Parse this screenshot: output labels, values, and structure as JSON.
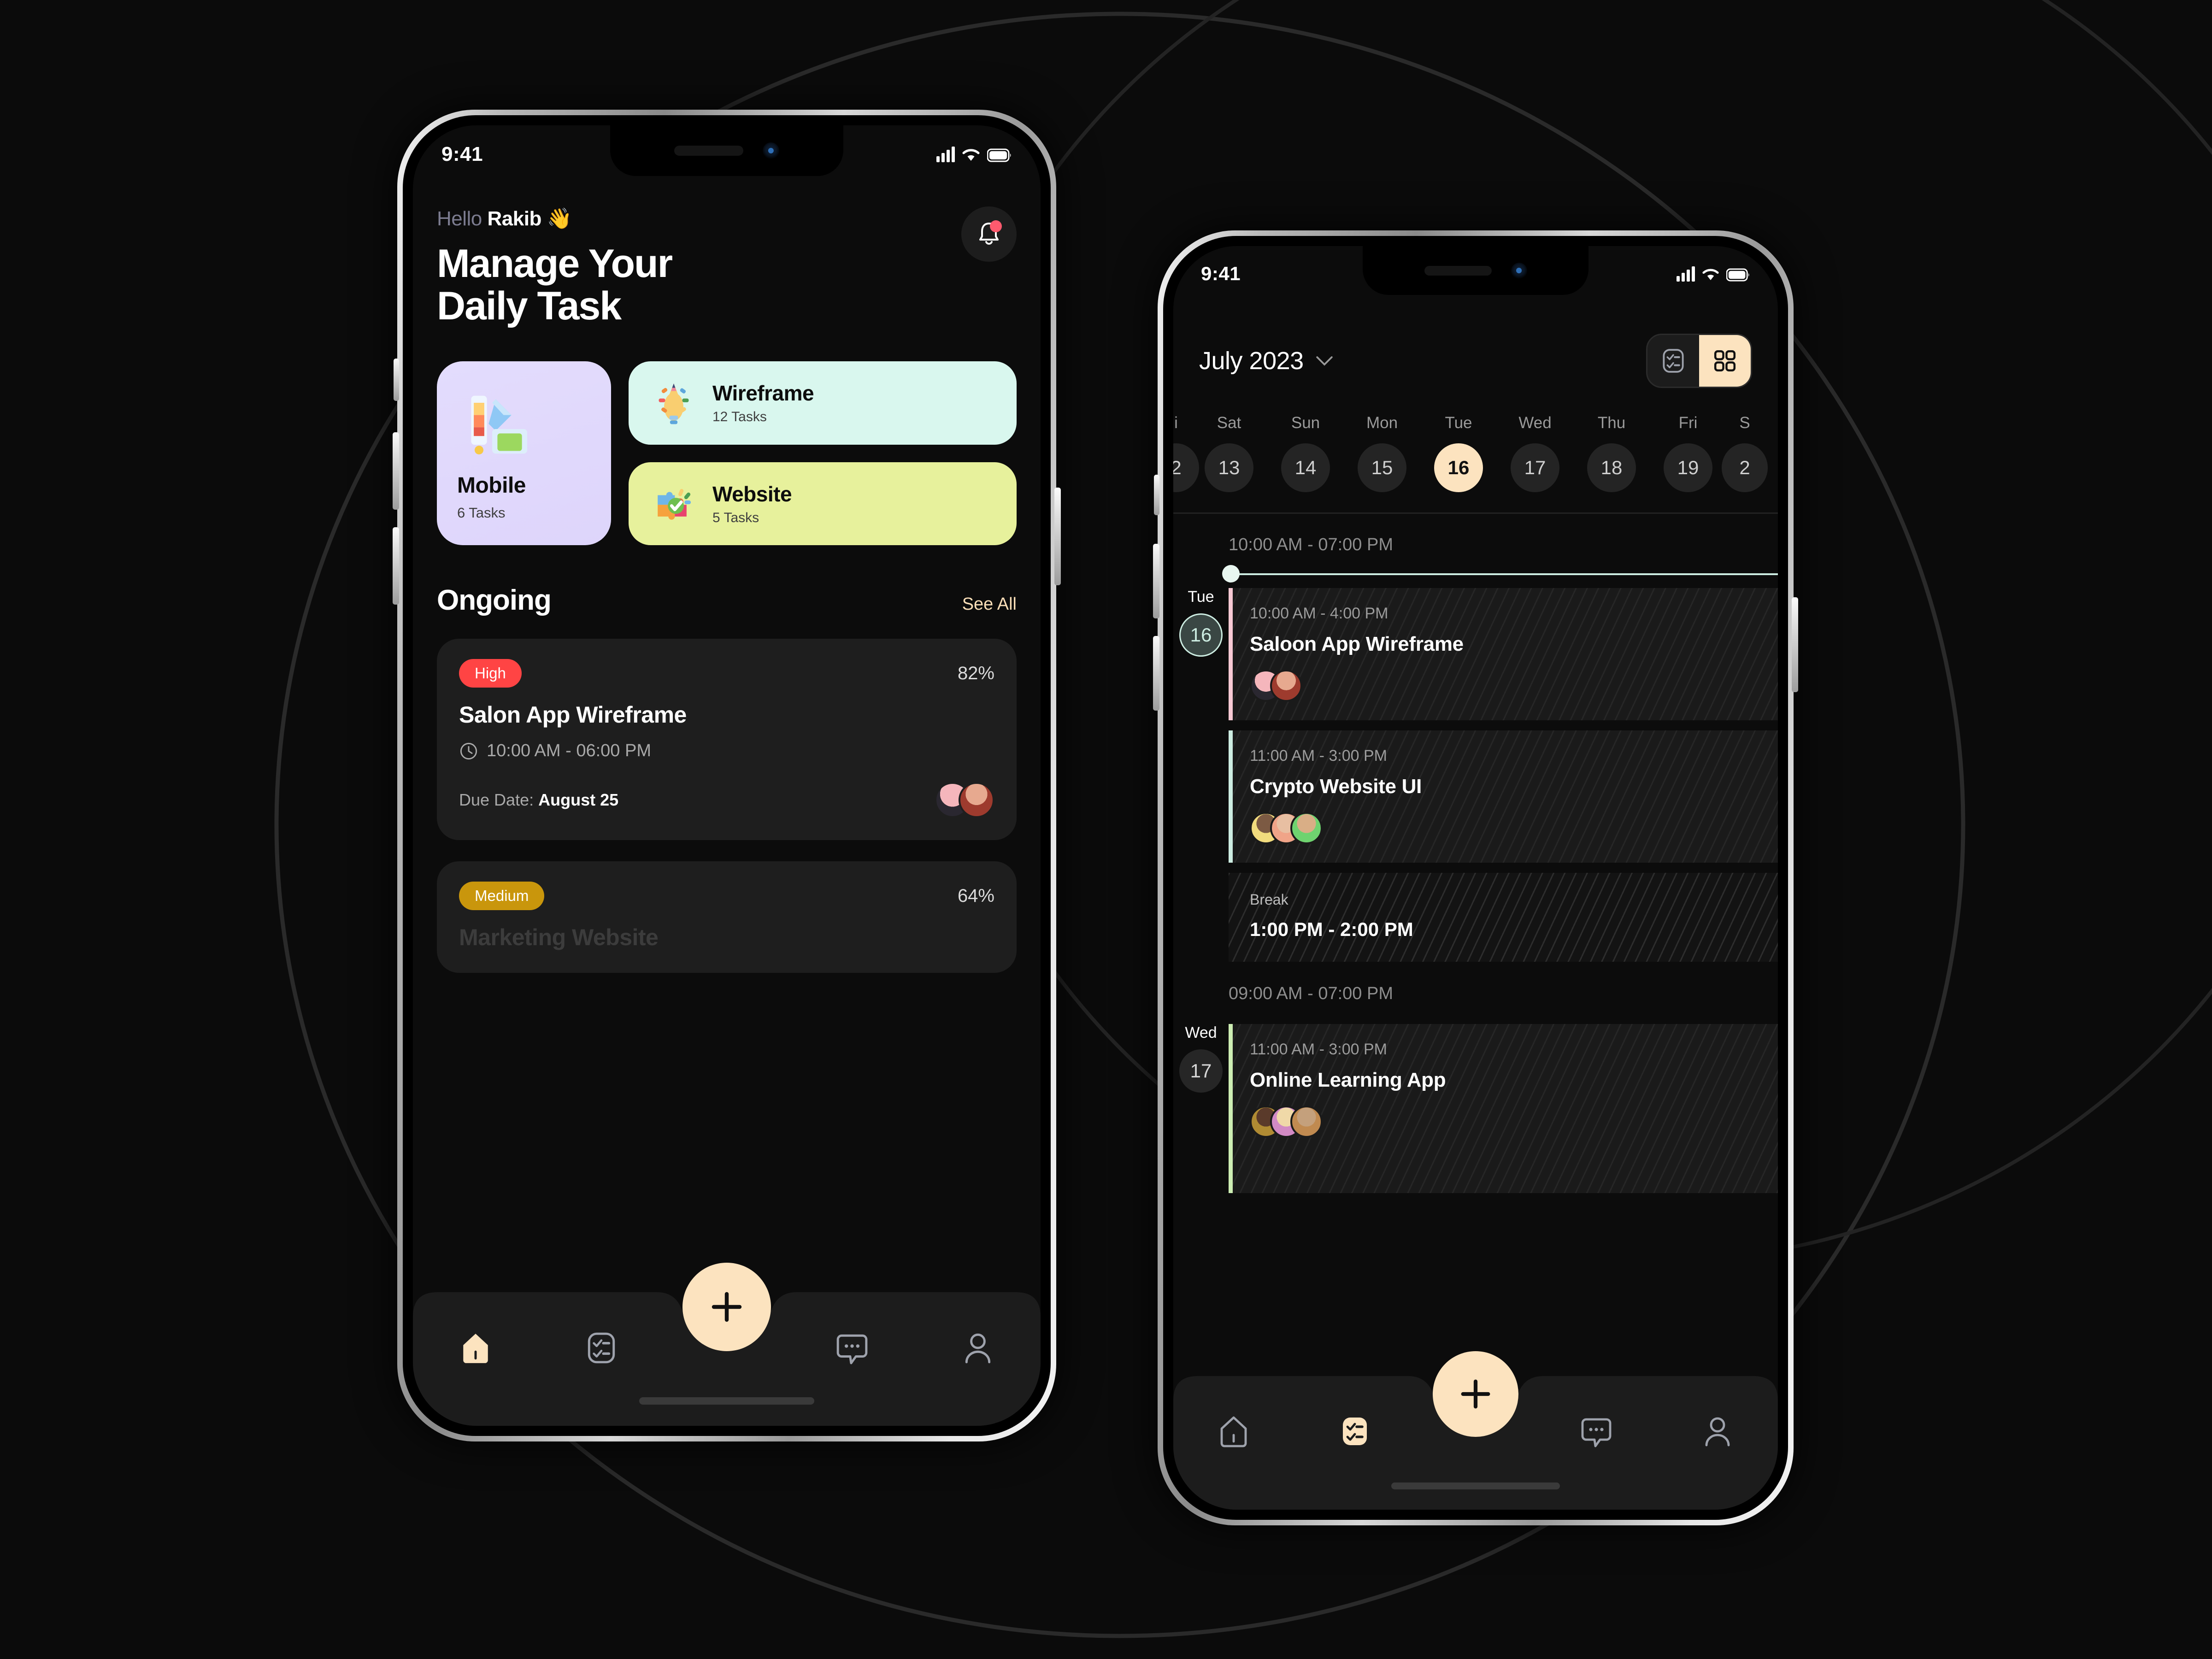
{
  "background": {
    "canvas_color": "#0B0B0B",
    "deco": "large-faint-ellipse-outlines"
  },
  "phone1": {
    "status_bar": {
      "time": "9:41",
      "signal_icon": "cellular-bars-icon",
      "wifi_icon": "wifi-icon",
      "battery_icon": "battery-icon"
    },
    "greeting": {
      "prefix": "Hello",
      "name": "Rakib",
      "emoji": "👋"
    },
    "title_line1": "Manage Your",
    "title_line2": "Daily Task",
    "notification": {
      "icon": "bell-icon",
      "has_unread": true,
      "dot_color": "#FF5A6E"
    },
    "category_cards": [
      {
        "name": "Mobile",
        "tasks": "6 Tasks",
        "bg": "#DED5FB",
        "icon": "design-tools-icon"
      },
      {
        "name": "Wireframe",
        "tasks": "12 Tasks",
        "bg": "#D9F7EE",
        "icon": "lightbulb-pencil-icon"
      },
      {
        "name": "Website",
        "tasks": "5 Tasks",
        "bg": "#E7F19C",
        "icon": "puzzle-check-icon"
      }
    ],
    "ongoing": {
      "heading": "Ongoing",
      "see_all": "See All",
      "see_all_color": "#FBDFB8"
    },
    "tasks": [
      {
        "priority": "High",
        "priority_color": "#FF4444",
        "percent": "82%",
        "title": "Salon App Wireframe",
        "time": "10:00 AM - 06:00 PM",
        "clock_icon": "clock-icon",
        "due_label": "Due Date:",
        "due_date": "August 25",
        "avatars": [
          "#F2A0A8",
          "#9E3B2E"
        ]
      },
      {
        "priority": "Medium",
        "priority_color": "#C9960C",
        "percent": "64%",
        "title": "Marketing Website",
        "time": "",
        "due_label": "",
        "due_date": "",
        "avatars": []
      }
    ],
    "tabbar": {
      "items": [
        {
          "icon": "home-icon",
          "active": true
        },
        {
          "icon": "tasks-icon",
          "active": false
        },
        {
          "icon": "messages-icon",
          "active": false
        },
        {
          "icon": "profile-icon",
          "active": false
        }
      ],
      "fab": {
        "icon": "plus-icon",
        "label": "+",
        "bg": "#FCE3BF"
      }
    }
  },
  "phone2": {
    "status_bar": {
      "time": "9:41",
      "signal_icon": "cellular-bars-icon",
      "wifi_icon": "wifi-icon",
      "battery_icon": "battery-icon"
    },
    "month": "July 2023",
    "month_chevron_icon": "chevron-down-icon",
    "view_toggle": {
      "list_icon": "list-view-icon",
      "grid_icon": "grid-view-icon",
      "active": "grid",
      "active_bg": "#FCE3BF"
    },
    "days": [
      {
        "dow": "i",
        "num": "2",
        "selected": false,
        "partial": true
      },
      {
        "dow": "Sat",
        "num": "13",
        "selected": false,
        "partial": false
      },
      {
        "dow": "Sun",
        "num": "14",
        "selected": false,
        "partial": false
      },
      {
        "dow": "Mon",
        "num": "15",
        "selected": false,
        "partial": false
      },
      {
        "dow": "Tue",
        "num": "16",
        "selected": true,
        "partial": false
      },
      {
        "dow": "Wed",
        "num": "17",
        "selected": false,
        "partial": false
      },
      {
        "dow": "Thu",
        "num": "18",
        "selected": false,
        "partial": false
      },
      {
        "dow": "Fri",
        "num": "19",
        "selected": false,
        "partial": false
      },
      {
        "dow": "S",
        "num": "2",
        "selected": false,
        "partial": true
      }
    ],
    "groups": [
      {
        "range": "10:00 AM - 07:00 PM",
        "rail": {
          "dow": "Tue",
          "num": "16",
          "accent": "#CDEDE2",
          "active": true
        },
        "events": [
          {
            "kind": "event",
            "time": "10:00 AM - 4:00 PM",
            "title": "Saloon App Wireframe",
            "accent": "#F8C9D4",
            "avatars": [
              "#F2A0A8",
              "#9E3B2E"
            ]
          },
          {
            "kind": "event",
            "time": "11:00 AM - 3:00 PM",
            "title": "Crypto Website UI",
            "accent": "#CDEDE2",
            "avatars": [
              "#F2DC7E",
              "#F0A488",
              "#6FD36F"
            ]
          },
          {
            "kind": "break",
            "label": "Break",
            "time": "1:00 PM - 2:00 PM"
          }
        ]
      },
      {
        "range": "09:00 AM - 07:00 PM",
        "rail": {
          "dow": "Wed",
          "num": "17",
          "accent": "#2A2A2A",
          "active": false
        },
        "events": [
          {
            "kind": "event",
            "time": "11:00 AM - 3:00 PM",
            "title": "Online Learning App",
            "accent": "#CDEEB3",
            "avatars": [
              "#B08B33",
              "#D28AC4",
              "#C08A50"
            ]
          }
        ]
      }
    ],
    "tabbar": {
      "items": [
        {
          "icon": "home-icon",
          "active": false
        },
        {
          "icon": "tasks-icon",
          "active": true
        },
        {
          "icon": "messages-icon",
          "active": false
        },
        {
          "icon": "profile-icon",
          "active": false
        }
      ],
      "fab": {
        "icon": "plus-icon",
        "label": "+",
        "bg": "#FCE3BF"
      }
    }
  }
}
